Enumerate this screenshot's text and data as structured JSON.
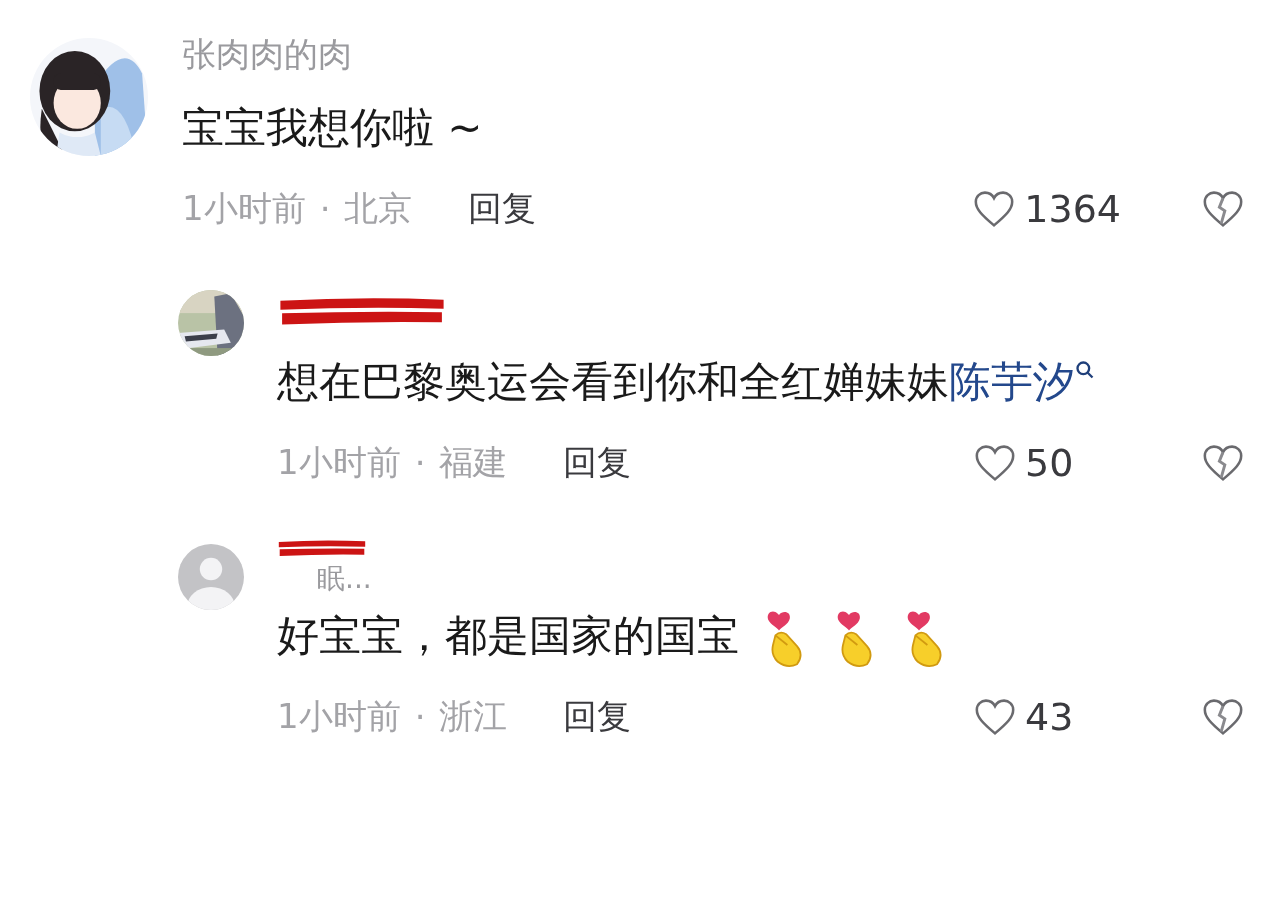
{
  "comments": [
    {
      "kind": "top",
      "username": "张肉肉的肉",
      "redacted": false,
      "text": "宝宝我想你啦 ~",
      "time": "1小时前",
      "location": "北京",
      "separator": "·",
      "reply": "回复",
      "likes": "1364"
    },
    {
      "kind": "reply",
      "redacted": true,
      "text": "想在巴黎奥运会看到你和全红婵妹妹",
      "link": "陈芋汐",
      "time": "1小时前",
      "location": "福建",
      "separator": "·",
      "reply": "回复",
      "likes": "50"
    },
    {
      "kind": "reply",
      "avatar": {
        "kind": "default"
      },
      "username": "眠...",
      "redacted": true,
      "text": "好宝宝，都是国家的国宝",
      "emojis": [
        {
          "kind": "finger-heart"
        },
        {
          "kind": "finger-heart"
        },
        {
          "kind": "finger-heart"
        }
      ],
      "time": "1小时前",
      "location": "浙江",
      "separator": "·",
      "reply": "回复",
      "likes": "43"
    }
  ]
}
